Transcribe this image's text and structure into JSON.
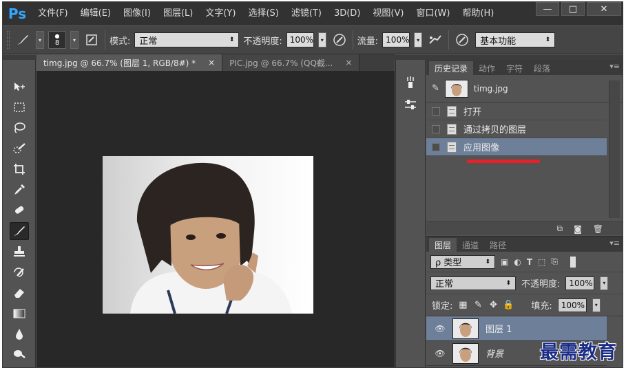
{
  "app": {
    "logo": "Ps",
    "menu": [
      "文件(F)",
      "编辑(E)",
      "图像(I)",
      "图层(L)",
      "文字(Y)",
      "选择(S)",
      "滤镜(T)",
      "3D(D)",
      "视图(V)",
      "窗口(W)",
      "帮助(H)"
    ],
    "window_controls": {
      "minimize": "—",
      "maximize": "□",
      "close": "✕"
    }
  },
  "options": {
    "brush_size": "8",
    "mode_label": "模式:",
    "mode_value": "正常",
    "opacity_label": "不透明度:",
    "opacity_value": "100%",
    "flow_label": "流量:",
    "flow_value": "100%",
    "workspace": "基本功能"
  },
  "documents": {
    "tabs": [
      {
        "label": "timg.jpg @ 66.7% (图层 1, RGB/8#) *",
        "close": "×"
      },
      {
        "label": "PIC.jpg @ 66.7% (QQ截...",
        "close": "×"
      }
    ]
  },
  "history_panel": {
    "tabs": [
      "历史记录",
      "动作",
      "字符",
      "段落"
    ],
    "snapshot": "timg.jpg",
    "items": [
      "打开",
      "通过拷贝的图层",
      "应用图像"
    ],
    "selected_index": 2
  },
  "layers_panel": {
    "tabs": [
      "图层",
      "通道",
      "路径"
    ],
    "filter_label": "ρ 类型",
    "blend_mode": "正常",
    "opacity_label": "不透明度:",
    "opacity_value": "100%",
    "lock_label": "锁定:",
    "fill_label": "填充:",
    "fill_value": "100%",
    "layers": [
      {
        "name": "图层 1",
        "selected": true
      },
      {
        "name": "背景",
        "selected": false
      }
    ]
  },
  "watermark": "最需教育",
  "colors": {
    "accent_blue": "#31a8ff",
    "selection": "#6d7f99",
    "annotation_red": "#e8202a"
  }
}
